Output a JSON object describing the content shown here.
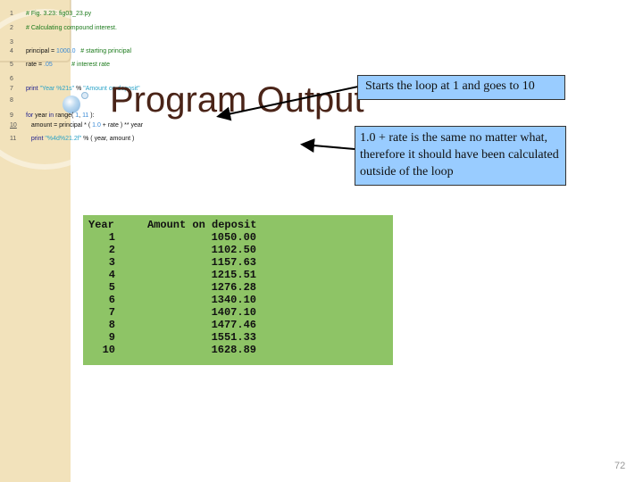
{
  "slide": {
    "title": "Program Output",
    "page_number": "72",
    "colors": {
      "left_strip": "#f2e2bb",
      "title": "#4a2418",
      "callout_bg": "#99ccff",
      "output_bg": "#8ec466",
      "comment": "#1b7a1b",
      "number": "#3a8ad6",
      "keyword": "#1a1a8c",
      "string": "#2aa3c8"
    }
  },
  "code": {
    "lines": [
      {
        "num": "1",
        "parts": [
          {
            "t": "# Fig. 3.23: fig03_23.py",
            "c": "comment"
          }
        ]
      },
      {
        "num": "2",
        "parts": [
          {
            "t": "# Calculating compound interest.",
            "c": "comment"
          }
        ]
      },
      {
        "num": "3",
        "parts": []
      },
      {
        "num": "4",
        "parts": [
          {
            "t": "principal = ",
            "c": "plain"
          },
          {
            "t": "1000.0",
            "c": "num"
          },
          {
            "t": "   # starting principal",
            "c": "comment"
          }
        ]
      },
      {
        "num": "5",
        "parts": [
          {
            "t": "rate = ",
            "c": "plain"
          },
          {
            "t": ".05",
            "c": "num"
          },
          {
            "t": "           # interest rate",
            "c": "comment"
          }
        ]
      },
      {
        "num": "6",
        "parts": []
      },
      {
        "num": "7",
        "parts": [
          {
            "t": "print ",
            "c": "kw"
          },
          {
            "t": "\"Year %21s\"",
            "c": "str"
          },
          {
            "t": " % ",
            "c": "plain"
          },
          {
            "t": "\"Amount on deposit\"",
            "c": "str"
          }
        ]
      },
      {
        "num": "8",
        "parts": []
      },
      {
        "num": "9",
        "parts": [
          {
            "t": "for",
            "c": "kw"
          },
          {
            "t": " year ",
            "c": "plain"
          },
          {
            "t": "in",
            "c": "kw"
          },
          {
            "t": " range( ",
            "c": "plain"
          },
          {
            "t": "1",
            "c": "num"
          },
          {
            "t": ", ",
            "c": "plain"
          },
          {
            "t": "11",
            "c": "num"
          },
          {
            "t": " ):",
            "c": "plain"
          }
        ]
      },
      {
        "num": "10",
        "parts": [
          {
            "t": "   amount = principal * ( ",
            "c": "plain"
          },
          {
            "t": "1.0",
            "c": "num"
          },
          {
            "t": " + rate ) ** year",
            "c": "plain"
          }
        ]
      },
      {
        "num": "11",
        "parts": [
          {
            "t": "   print ",
            "c": "kw"
          },
          {
            "t": "\"%4d%21.2f\"",
            "c": "str"
          },
          {
            "t": " % ( year, amount )",
            "c": "plain"
          }
        ]
      }
    ]
  },
  "callouts": [
    {
      "text": "Starts the loop at 1 and goes to 10"
    },
    {
      "text": "1.0 + rate is the same no matter what, therefore it should have been calculated outside of the loop"
    }
  ],
  "output": {
    "headers": {
      "year": "Year",
      "amount": "Amount on deposit"
    },
    "rows": [
      {
        "year": "1",
        "amount": "1050.00"
      },
      {
        "year": "2",
        "amount": "1102.50"
      },
      {
        "year": "3",
        "amount": "1157.63"
      },
      {
        "year": "4",
        "amount": "1215.51"
      },
      {
        "year": "5",
        "amount": "1276.28"
      },
      {
        "year": "6",
        "amount": "1340.10"
      },
      {
        "year": "7",
        "amount": "1407.10"
      },
      {
        "year": "8",
        "amount": "1477.46"
      },
      {
        "year": "9",
        "amount": "1551.33"
      },
      {
        "year": "10",
        "amount": "1628.89"
      }
    ]
  }
}
